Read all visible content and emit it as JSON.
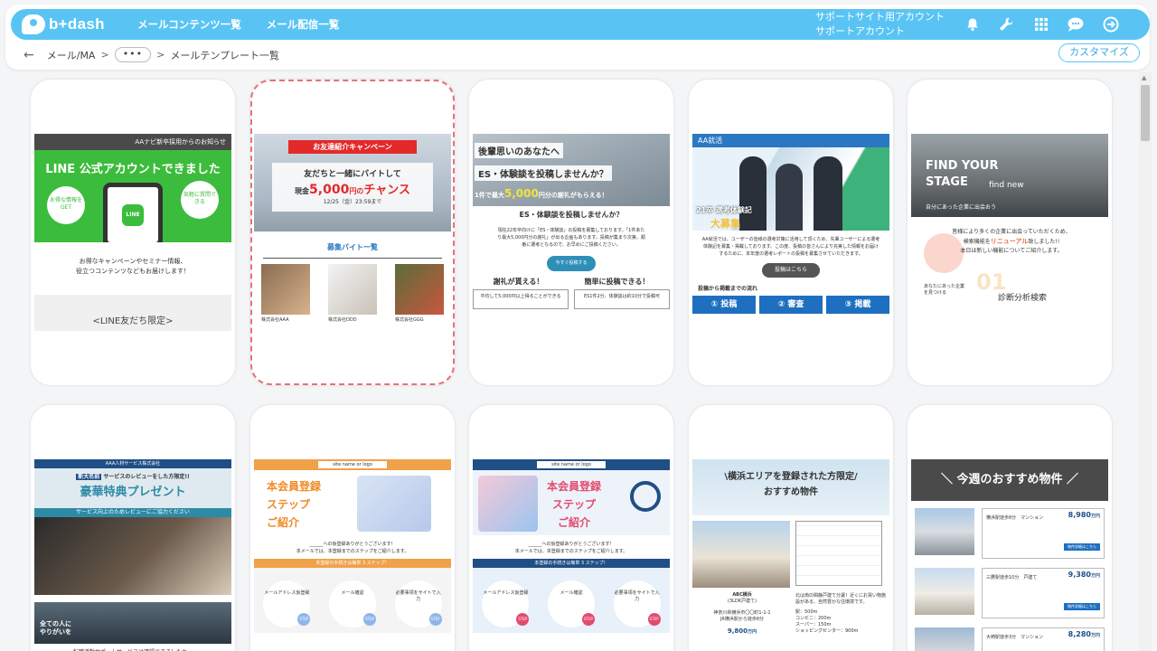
{
  "header": {
    "logo": "b+dash",
    "nav": [
      "メールコンテンツ一覧",
      "メール配信一覧"
    ],
    "account_line1": "サポートサイト用アカウント",
    "account_line2": "サポートアカウント",
    "icons": [
      "bell-icon",
      "wrench-icon",
      "grid-icon",
      "chat-icon",
      "logout-icon"
    ]
  },
  "breadcrumb": {
    "items": [
      "メール/MA",
      "•••",
      "メールテンプレート一覧"
    ]
  },
  "customize_label": "カスタマイズ",
  "cards": [
    {
      "header_text": "AAナビ新卒採用からのお知らせ",
      "title": "LINE 公式アカウントできました",
      "bubble_left": "お得な情報をGET",
      "bubble_right": "気軽に質問できる",
      "line_label": "LINE",
      "body1": "お得なキャンペーンやセミナー情報、",
      "body2": "役立つコンテンツなどもお届けします！",
      "footer": "<LINE友だち限定>"
    },
    {
      "banner": "お友達紹介キャンペーン",
      "line1": "友だちと一緒にバイトして",
      "line2_pre": "現金",
      "line2_amount": "5,000",
      "line2_unit": "円の",
      "line2_post": "チャンス",
      "date": "12/25（金）23:59まで",
      "section": "募集バイト一覧",
      "shops": [
        "株式会社AAA",
        "株式会社DDD",
        "株式会社GGG"
      ]
    },
    {
      "top1": "後輩思いのあなたへ",
      "top2": "ES・体験談を投稿しませんか？",
      "top3_pre": "1件で最大",
      "top3_amount": "5,000",
      "top3_post": "円分の謝礼がもらえる！",
      "sub": "ES・体験談を投稿しませんか？",
      "body": "現在22年卒向けに「ES・体験談」の投稿を募集しております。「1件あたり最大5,000円分の謝礼」が出る企画もあります。投稿が集まり次第、順番に選考となるので、お早めにご投稿ください。",
      "cta": "今すぐ投稿する",
      "left_head": "謝礼が貰える！",
      "right_head": "簡単に投稿できる！",
      "left_box": "平均して5,000円以上得ることができる",
      "right_box": "ES1件2分、体験談は約10分で投稿可"
    },
    {
      "tag": "AA就活",
      "caption1": "21卒 選考体験記",
      "caption2": "大募集",
      "body": "AA就活では、ユーザーの皆様の選考対策に活用して頂くため、先輩ユーザーによる選考体験記を募集・掲載しております。この度、投稿の皆さんにより充実した情報をお届けするために、本年度の選考レポートの投稿を募集させていただきます。",
      "cta": "投稿はこちら",
      "flow_title": "投稿から掲載までの流れ",
      "steps": [
        "投稿",
        "審査",
        "掲載"
      ]
    },
    {
      "hero1": "FIND YOUR",
      "hero2": "STAGE",
      "hero3": "find new",
      "hero4": "自分にあった企業に出会おう",
      "body1": "皆様により多くの企業に出会っていただくため、",
      "body2_pre": "検索機能を",
      "body2_em": "リニューアル",
      "body2_post": "致しました!!",
      "body3": "本日は新しい機能についてご紹介します。",
      "num": "01",
      "small": "あなたにあった企業を見つける",
      "feature": "診断分析検索"
    },
    {
      "header": "AAA人材サービス株式会社",
      "pre": "サービスのレビューをした方限定!!",
      "pre_tag": "新大名前",
      "title": "豪華特典プレゼント",
      "sub": "サービス向上のためレビューにご協力ください",
      "lower1": "全ての人に",
      "lower2": "やりがいを",
      "footer": "転職活動サポートサービスは確認できましたか、"
    },
    {
      "logo": "site name or logo",
      "title1": "本会員登録",
      "title2": "ステップ",
      "title3": "ご紹介",
      "body1": "______への仮登録ありがとうございます！",
      "body2": "本メールでは、本登録までのステップをご紹介します。",
      "band": "本登録の手続きは簡単 3 ステップ！",
      "steps": [
        "メールアドレス仮登録",
        "メール確認",
        "必要事項をサイトで入力"
      ],
      "step_label": "STEP"
    },
    {
      "logo": "site name or logo",
      "title1": "本会員登録",
      "title2": "ステップ",
      "title3": "ご紹介",
      "body1": "______への仮登録ありがとうございます！",
      "body2": "本メールでは、本登録までのステップをご紹介します。",
      "band": "本登録の手続きは簡単 3 ステップ！",
      "steps": [
        "メールアドレス仮登録",
        "メール確認",
        "必要事項をサイトで入力"
      ],
      "step_label": "STEP"
    },
    {
      "title1": "\\横浜エリアを登録された方限定/",
      "title2": "おすすめ物件",
      "prop_name": "ABC横浜",
      "prop_layout": "(3LDK戸建て)",
      "addr": "神奈川県横浜市〇〇町1-1-1",
      "station": "JR横浜駅から徒歩8分",
      "price": "9,800",
      "unit": "万円",
      "desc": "北は南の閑静戸建て分譲！近くにお買い物施設がある、自然豊かな住環境です。",
      "near": [
        "駅：500m",
        "コンビニ：200m",
        "スーパー：150m",
        "ショッピングセンター：900m"
      ]
    },
    {
      "title": "今週のおすすめ物件",
      "items": [
        {
          "name": "横浜駅徒歩8分　マンション",
          "price": "8,980",
          "unit": "万円"
        },
        {
          "name": "三鷹駅徒歩10分　戸建て",
          "price": "9,380",
          "unit": "万円"
        },
        {
          "name": "大崎駅徒歩3分　マンション",
          "price": "8,280",
          "unit": "万円"
        }
      ],
      "btn": "物件詳細はこちら"
    }
  ]
}
